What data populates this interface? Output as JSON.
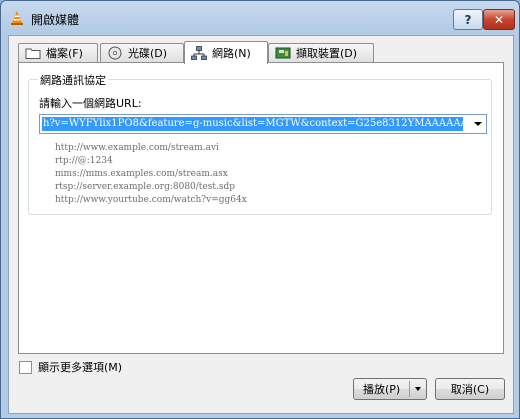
{
  "window": {
    "title": "開啟媒體",
    "help_glyph": "?",
    "close_glyph": "✕"
  },
  "tabs": [
    {
      "label": "檔案(F)",
      "icon": "folder-icon"
    },
    {
      "label": "光碟(D)",
      "icon": "disc-icon"
    },
    {
      "label": "網路(N)",
      "icon": "network-icon",
      "active": true
    },
    {
      "label": "擷取裝置(D)",
      "icon": "capture-device-icon"
    }
  ],
  "network": {
    "group_title": "網路通訊協定",
    "url_label": "請輸入一個網路URL:",
    "url_value": "h?v=WYFYlix1PO8&feature=g-music&list=MGTW&context=G25e8312YMAAAAAAAPAA",
    "examples": [
      "http://www.example.com/stream.avi",
      "rtp://@:1234",
      "mms://mms.examples.com/stream.asx",
      "rtsp://server.example.org:8080/test.sdp",
      "http://www.yourtube.com/watch?v=gg64x"
    ]
  },
  "options": {
    "show_more_label": "顯示更多選項(M)",
    "show_more_checked": false
  },
  "buttons": {
    "play_label": "播放(P)",
    "cancel_label": "取消(C)"
  },
  "colors": {
    "selection": "#3399ff",
    "close_button": "#c8452f"
  }
}
